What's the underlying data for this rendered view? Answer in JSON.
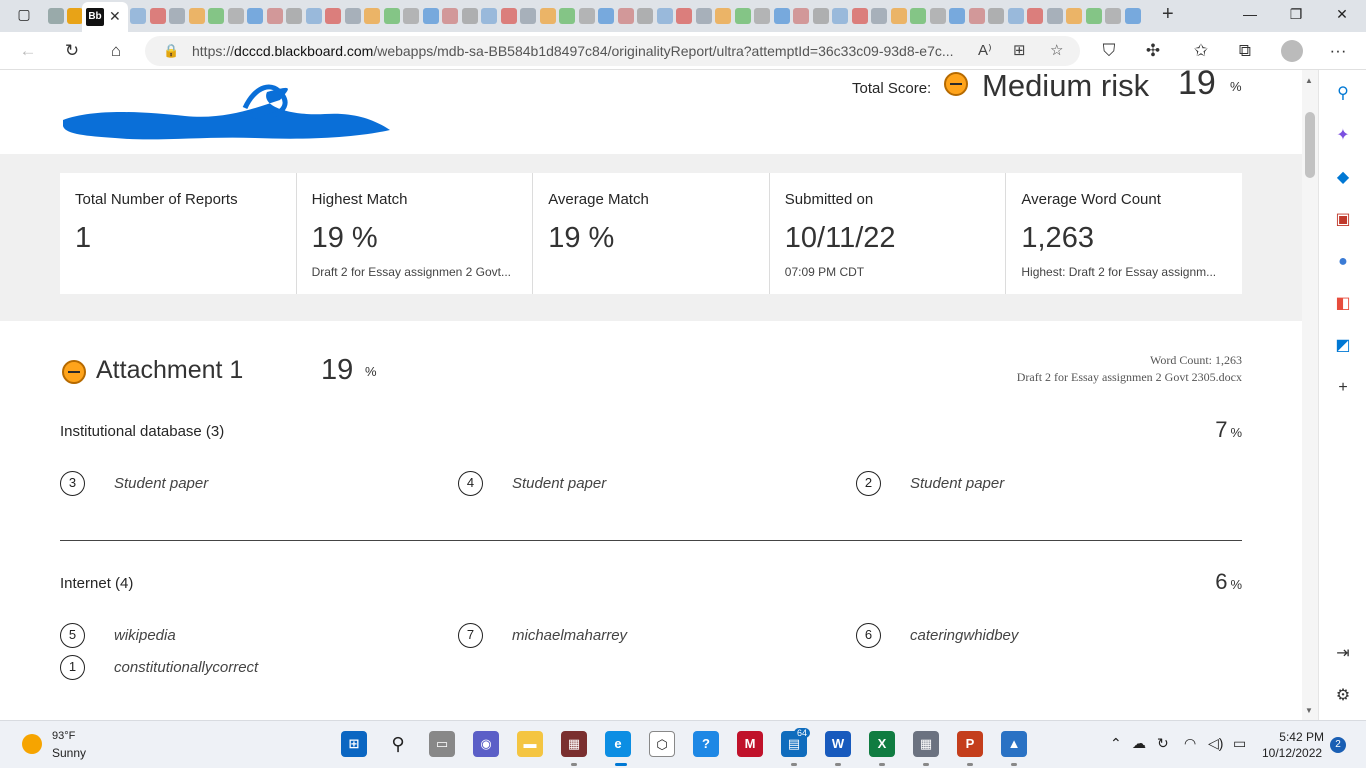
{
  "browser": {
    "active_tab_short": "Bb",
    "address": {
      "prefix": "https://",
      "domain": "dcccd.blackboard.com",
      "path": "/webapps/mdb-sa-BB584b1d8497c84/originalityReport/ultra?attemptId=36c33c09-93d8-e7c..."
    }
  },
  "report": {
    "total_score_label": "Total Score:",
    "risk_level": "Medium risk",
    "score": "19",
    "pct": "%",
    "stats": [
      {
        "label": "Total Number of Reports",
        "value": "1",
        "sub": ""
      },
      {
        "label": "Highest Match",
        "value": "19 %",
        "sub": "Draft 2 for Essay assignmen 2 Govt..."
      },
      {
        "label": "Average Match",
        "value": "19 %",
        "sub": ""
      },
      {
        "label": "Submitted on",
        "value": "10/11/22",
        "sub": "07:09 PM CDT"
      },
      {
        "label": "Average Word Count",
        "value": "1,263",
        "sub": "Highest: Draft 2 for Essay assignm..."
      }
    ],
    "attachment": {
      "title": "Attachment 1",
      "score": "19",
      "pct": "%",
      "word_count": "Word Count: 1,263",
      "filename": "Draft 2 for Essay assignmen 2 Govt 2305.docx"
    },
    "sections": [
      {
        "title": "Institutional database (3)",
        "pct": "7",
        "sources": [
          {
            "num": "3",
            "name": "Student paper"
          },
          {
            "num": "4",
            "name": "Student paper"
          },
          {
            "num": "2",
            "name": "Student paper"
          }
        ]
      },
      {
        "title": "Internet (4)",
        "pct": "6",
        "sources": [
          {
            "num": "5",
            "name": "wikipedia"
          },
          {
            "num": "7",
            "name": "michaelmaharrey"
          },
          {
            "num": "6",
            "name": "cateringwhidbey"
          },
          {
            "num": "1",
            "name": "constitutionallycorrect"
          }
        ]
      }
    ]
  },
  "taskbar": {
    "weather_temp": "93°F",
    "weather_cond": "Sunny",
    "time": "5:42 PM",
    "date": "10/12/2022",
    "notification_count": "2",
    "teams_badge": "64"
  },
  "colors": {
    "risk_orange": "#ffa41b",
    "stats_band": "#f0f0f0",
    "edge_blue": "#0078d4"
  }
}
